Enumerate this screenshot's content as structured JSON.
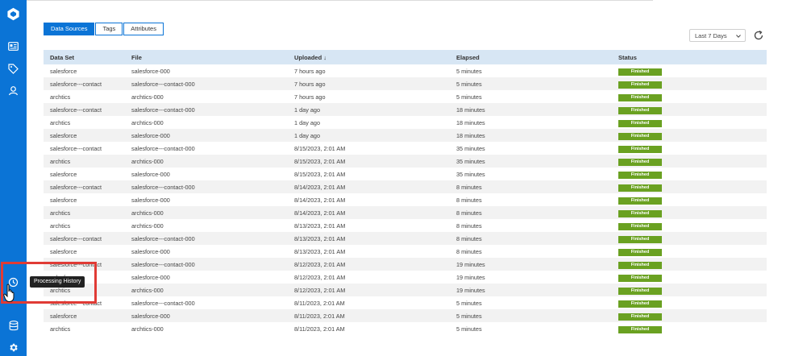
{
  "tabs": [
    {
      "label": "Data Sources",
      "active": true
    },
    {
      "label": "Tags",
      "active": false
    },
    {
      "label": "Attributes",
      "active": false
    }
  ],
  "range": {
    "selected": "Last 7 Days"
  },
  "table": {
    "headers": [
      "Data Set",
      "File",
      "Uploaded ↓",
      "Elapsed",
      "Status"
    ],
    "rows": [
      [
        "salesforce",
        "salesforce-000",
        "7 hours ago",
        "5 minutes",
        "Finished"
      ],
      [
        "salesforce---contact",
        "salesforce---contact-000",
        "7 hours ago",
        "5 minutes",
        "Finished"
      ],
      [
        "archtics",
        "archtics-000",
        "7 hours ago",
        "5 minutes",
        "Finished"
      ],
      [
        "salesforce---contact",
        "salesforce---contact-000",
        "1 day ago",
        "18 minutes",
        "Finished"
      ],
      [
        "archtics",
        "archtics-000",
        "1 day ago",
        "18 minutes",
        "Finished"
      ],
      [
        "salesforce",
        "salesforce-000",
        "1 day ago",
        "18 minutes",
        "Finished"
      ],
      [
        "salesforce---contact",
        "salesforce---contact-000",
        "8/15/2023, 2:01 AM",
        "35 minutes",
        "Finished"
      ],
      [
        "archtics",
        "archtics-000",
        "8/15/2023, 2:01 AM",
        "35 minutes",
        "Finished"
      ],
      [
        "salesforce",
        "salesforce-000",
        "8/15/2023, 2:01 AM",
        "35 minutes",
        "Finished"
      ],
      [
        "salesforce---contact",
        "salesforce---contact-000",
        "8/14/2023, 2:01 AM",
        "8 minutes",
        "Finished"
      ],
      [
        "salesforce",
        "salesforce-000",
        "8/14/2023, 2:01 AM",
        "8 minutes",
        "Finished"
      ],
      [
        "archtics",
        "archtics-000",
        "8/14/2023, 2:01 AM",
        "8 minutes",
        "Finished"
      ],
      [
        "archtics",
        "archtics-000",
        "8/13/2023, 2:01 AM",
        "8 minutes",
        "Finished"
      ],
      [
        "salesforce---contact",
        "salesforce---contact-000",
        "8/13/2023, 2:01 AM",
        "8 minutes",
        "Finished"
      ],
      [
        "salesforce",
        "salesforce-000",
        "8/13/2023, 2:01 AM",
        "8 minutes",
        "Finished"
      ],
      [
        "salesforce---contact",
        "salesforce---contact-000",
        "8/12/2023, 2:01 AM",
        "19 minutes",
        "Finished"
      ],
      [
        "salesforce",
        "salesforce-000",
        "8/12/2023, 2:01 AM",
        "19 minutes",
        "Finished"
      ],
      [
        "archtics",
        "archtics-000",
        "8/12/2023, 2:01 AM",
        "19 minutes",
        "Finished"
      ],
      [
        "salesforce---contact",
        "salesforce---contact-000",
        "8/11/2023, 2:01 AM",
        "5 minutes",
        "Finished"
      ],
      [
        "salesforce",
        "salesforce-000",
        "8/11/2023, 2:01 AM",
        "5 minutes",
        "Finished"
      ],
      [
        "archtics",
        "archtics-000",
        "8/11/2023, 2:01 AM",
        "5 minutes",
        "Finished"
      ]
    ]
  },
  "tooltip": {
    "text": "Processing History"
  },
  "colors": {
    "accent": "#0b74d6",
    "header_bg": "#d7e6f4",
    "status_finished": "#6aa121",
    "highlight": "#e03b35"
  },
  "icons": [
    "logo-icon",
    "id-card-icon",
    "tag-icon",
    "person-icon",
    "history-icon",
    "database-icon",
    "gear-icon",
    "refresh-icon",
    "chevron-down-icon",
    "hand-cursor-icon"
  ]
}
